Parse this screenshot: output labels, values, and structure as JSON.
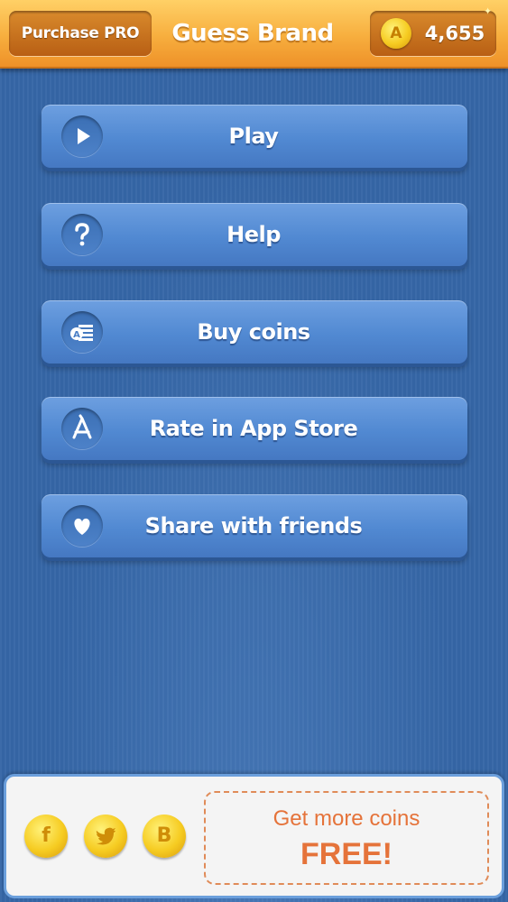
{
  "header": {
    "purchase_label": "Purchase PRO",
    "title": "Guess Brand",
    "coin_icon": "coin-icon",
    "coin_symbol": "A",
    "coin_count": "4,655"
  },
  "menu": {
    "items": [
      {
        "label": "Play",
        "icon": "play-icon"
      },
      {
        "label": "Help",
        "icon": "question-icon"
      },
      {
        "label": "Buy coins",
        "icon": "coins-stack-icon"
      },
      {
        "label": "Rate in App Store",
        "icon": "app-store-icon"
      },
      {
        "label": "Share with friends",
        "icon": "heart-icon"
      }
    ]
  },
  "bottom": {
    "social": [
      {
        "name": "facebook",
        "glyph": "f"
      },
      {
        "name": "twitter",
        "glyph": ""
      },
      {
        "name": "blog",
        "glyph": "B"
      }
    ],
    "promo_line1": "Get more coins",
    "promo_line2": "FREE!"
  },
  "colors": {
    "background": "#3566a6",
    "header_orange": "#f7ae3e",
    "button_blue": "#5189d2",
    "promo_orange": "#e5733a",
    "coin_gold": "#f6cc22"
  }
}
